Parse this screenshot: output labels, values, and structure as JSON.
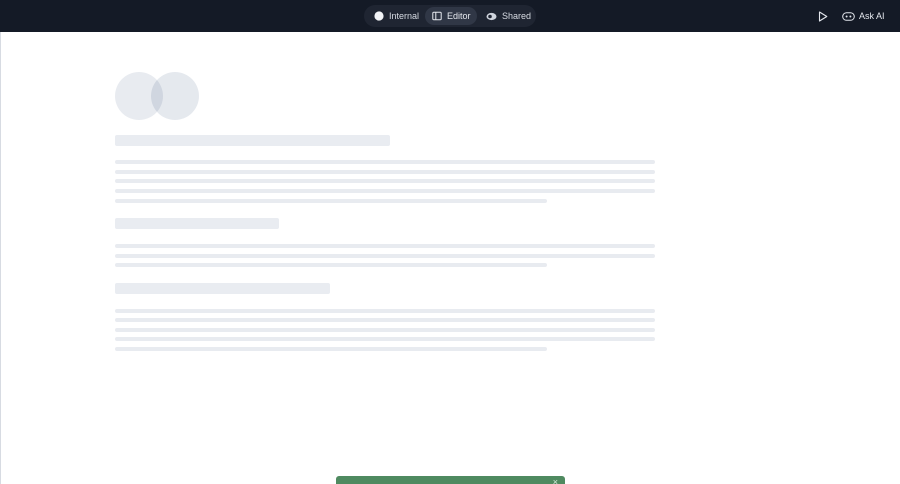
{
  "topbar": {
    "modes": [
      {
        "label": "Internal",
        "icon": "circle-icon",
        "active": false
      },
      {
        "label": "Editor",
        "icon": "sidebar-panel-icon",
        "active": true
      },
      {
        "label": "Shared",
        "icon": "eye-icon",
        "active": false
      }
    ],
    "play_icon": "play-icon",
    "ask_ai_label": "Ask AI",
    "ask_ai_icon": "cloud-ai-icon"
  },
  "toast": {
    "close_icon": "close-icon",
    "close_glyph": "×",
    "color": "#4f8a60"
  },
  "colors": {
    "topbar_bg": "#141a26",
    "skeleton": "#e9ecf1"
  }
}
